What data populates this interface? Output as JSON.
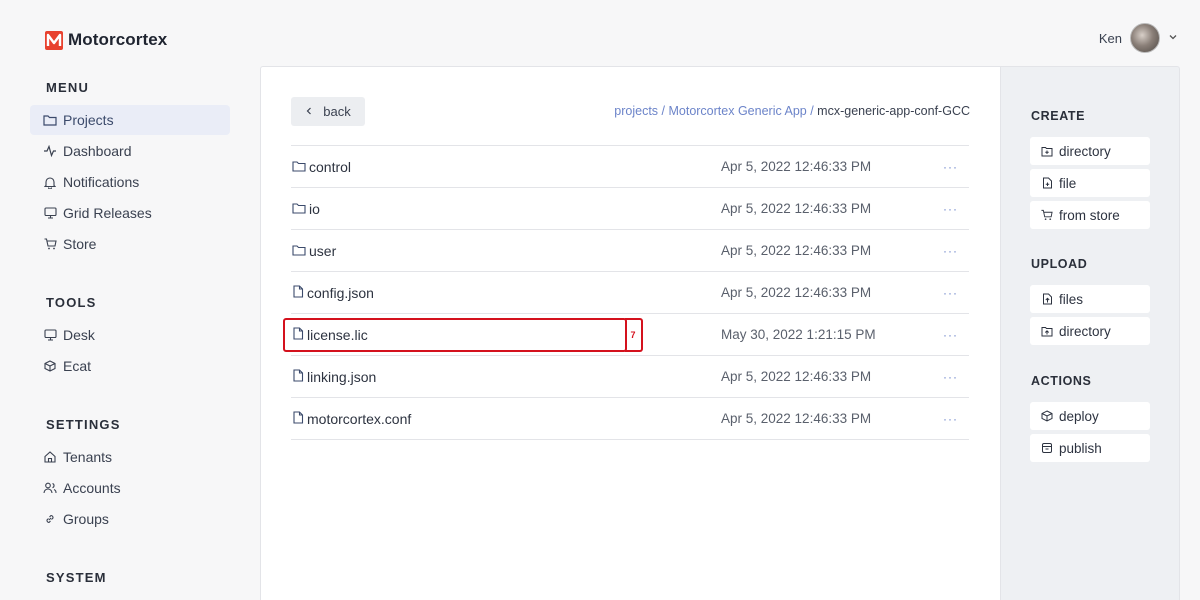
{
  "brand": {
    "name": "Motorcortex"
  },
  "user": {
    "name": "Ken"
  },
  "sidebar": {
    "menu_title": "MENU",
    "menu_items": [
      {
        "label": "Projects",
        "icon": "folder-icon"
      },
      {
        "label": "Dashboard",
        "icon": "activity-icon"
      },
      {
        "label": "Notifications",
        "icon": "bell-icon"
      },
      {
        "label": "Grid Releases",
        "icon": "monitor-icon"
      },
      {
        "label": "Store",
        "icon": "cart-icon"
      }
    ],
    "tools_title": "TOOLS",
    "tools_items": [
      {
        "label": "Desk",
        "icon": "monitor-icon"
      },
      {
        "label": "Ecat",
        "icon": "cube-icon"
      }
    ],
    "settings_title": "SETTINGS",
    "settings_items": [
      {
        "label": "Tenants",
        "icon": "home-icon"
      },
      {
        "label": "Accounts",
        "icon": "users-icon"
      },
      {
        "label": "Groups",
        "icon": "link-icon"
      }
    ],
    "system_title": "SYSTEM"
  },
  "main": {
    "back_label": "back",
    "breadcrumb": {
      "projects": "projects",
      "sep1": " / ",
      "app": "Motorcortex Generic App",
      "sep2": " / ",
      "current": "mcx-generic-app-conf-GCC"
    },
    "more_label": "···",
    "highlight_label": "7",
    "files": [
      {
        "name": "control",
        "type": "folder",
        "date": "Apr 5, 2022 12:46:33 PM"
      },
      {
        "name": "io",
        "type": "folder",
        "date": "Apr 5, 2022 12:46:33 PM"
      },
      {
        "name": "user",
        "type": "folder",
        "date": "Apr 5, 2022 12:46:33 PM"
      },
      {
        "name": "config.json",
        "type": "file",
        "date": "Apr 5, 2022 12:46:33 PM"
      },
      {
        "name": "license.lic",
        "type": "file",
        "date": "May 30, 2022 1:21:15 PM"
      },
      {
        "name": "linking.json",
        "type": "file",
        "date": "Apr 5, 2022 12:46:33 PM"
      },
      {
        "name": "motorcortex.conf",
        "type": "file",
        "date": "Apr 5, 2022 12:46:33 PM"
      }
    ]
  },
  "right": {
    "create_title": "CREATE",
    "create_directory": "directory",
    "create_file": "file",
    "create_from_store": "from store",
    "upload_title": "UPLOAD",
    "upload_files": "files",
    "upload_directory": "directory",
    "actions_title": "ACTIONS",
    "action_deploy": "deploy",
    "action_publish": "publish"
  },
  "colors": {
    "accent": "#6c84c9",
    "brand": "#e8412e",
    "highlight": "#d4111d"
  }
}
